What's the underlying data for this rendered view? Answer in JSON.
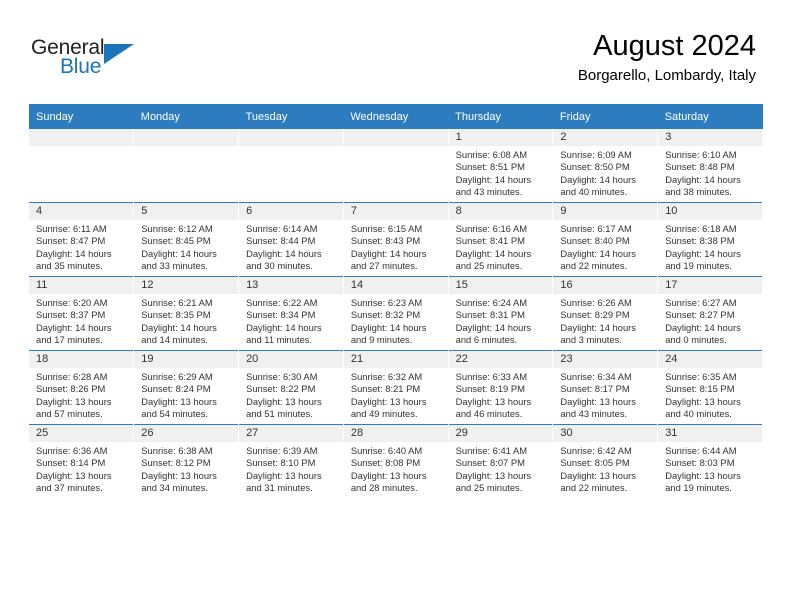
{
  "brand": {
    "name_part1": "General",
    "name_part2": "Blue",
    "accent_color": "#1b75bb"
  },
  "header": {
    "title": "August 2024",
    "location": "Borgarello, Lombardy, Italy",
    "header_bg_color": "#2e7cc0"
  },
  "weekday_headers": [
    "Sunday",
    "Monday",
    "Tuesday",
    "Wednesday",
    "Thursday",
    "Friday",
    "Saturday"
  ],
  "weeks": [
    [
      {
        "day": "",
        "empty": true
      },
      {
        "day": "",
        "empty": true
      },
      {
        "day": "",
        "empty": true
      },
      {
        "day": "",
        "empty": true
      },
      {
        "day": "1",
        "sunrise": "Sunrise: 6:08 AM",
        "sunset": "Sunset: 8:51 PM",
        "daylight_line1": "Daylight: 14 hours",
        "daylight_line2": "and 43 minutes."
      },
      {
        "day": "2",
        "sunrise": "Sunrise: 6:09 AM",
        "sunset": "Sunset: 8:50 PM",
        "daylight_line1": "Daylight: 14 hours",
        "daylight_line2": "and 40 minutes."
      },
      {
        "day": "3",
        "sunrise": "Sunrise: 6:10 AM",
        "sunset": "Sunset: 8:48 PM",
        "daylight_line1": "Daylight: 14 hours",
        "daylight_line2": "and 38 minutes."
      }
    ],
    [
      {
        "day": "4",
        "sunrise": "Sunrise: 6:11 AM",
        "sunset": "Sunset: 8:47 PM",
        "daylight_line1": "Daylight: 14 hours",
        "daylight_line2": "and 35 minutes."
      },
      {
        "day": "5",
        "sunrise": "Sunrise: 6:12 AM",
        "sunset": "Sunset: 8:45 PM",
        "daylight_line1": "Daylight: 14 hours",
        "daylight_line2": "and 33 minutes."
      },
      {
        "day": "6",
        "sunrise": "Sunrise: 6:14 AM",
        "sunset": "Sunset: 8:44 PM",
        "daylight_line1": "Daylight: 14 hours",
        "daylight_line2": "and 30 minutes."
      },
      {
        "day": "7",
        "sunrise": "Sunrise: 6:15 AM",
        "sunset": "Sunset: 8:43 PM",
        "daylight_line1": "Daylight: 14 hours",
        "daylight_line2": "and 27 minutes."
      },
      {
        "day": "8",
        "sunrise": "Sunrise: 6:16 AM",
        "sunset": "Sunset: 8:41 PM",
        "daylight_line1": "Daylight: 14 hours",
        "daylight_line2": "and 25 minutes."
      },
      {
        "day": "9",
        "sunrise": "Sunrise: 6:17 AM",
        "sunset": "Sunset: 8:40 PM",
        "daylight_line1": "Daylight: 14 hours",
        "daylight_line2": "and 22 minutes."
      },
      {
        "day": "10",
        "sunrise": "Sunrise: 6:18 AM",
        "sunset": "Sunset: 8:38 PM",
        "daylight_line1": "Daylight: 14 hours",
        "daylight_line2": "and 19 minutes."
      }
    ],
    [
      {
        "day": "11",
        "sunrise": "Sunrise: 6:20 AM",
        "sunset": "Sunset: 8:37 PM",
        "daylight_line1": "Daylight: 14 hours",
        "daylight_line2": "and 17 minutes."
      },
      {
        "day": "12",
        "sunrise": "Sunrise: 6:21 AM",
        "sunset": "Sunset: 8:35 PM",
        "daylight_line1": "Daylight: 14 hours",
        "daylight_line2": "and 14 minutes."
      },
      {
        "day": "13",
        "sunrise": "Sunrise: 6:22 AM",
        "sunset": "Sunset: 8:34 PM",
        "daylight_line1": "Daylight: 14 hours",
        "daylight_line2": "and 11 minutes."
      },
      {
        "day": "14",
        "sunrise": "Sunrise: 6:23 AM",
        "sunset": "Sunset: 8:32 PM",
        "daylight_line1": "Daylight: 14 hours",
        "daylight_line2": "and 9 minutes."
      },
      {
        "day": "15",
        "sunrise": "Sunrise: 6:24 AM",
        "sunset": "Sunset: 8:31 PM",
        "daylight_line1": "Daylight: 14 hours",
        "daylight_line2": "and 6 minutes."
      },
      {
        "day": "16",
        "sunrise": "Sunrise: 6:26 AM",
        "sunset": "Sunset: 8:29 PM",
        "daylight_line1": "Daylight: 14 hours",
        "daylight_line2": "and 3 minutes."
      },
      {
        "day": "17",
        "sunrise": "Sunrise: 6:27 AM",
        "sunset": "Sunset: 8:27 PM",
        "daylight_line1": "Daylight: 14 hours",
        "daylight_line2": "and 0 minutes."
      }
    ],
    [
      {
        "day": "18",
        "sunrise": "Sunrise: 6:28 AM",
        "sunset": "Sunset: 8:26 PM",
        "daylight_line1": "Daylight: 13 hours",
        "daylight_line2": "and 57 minutes."
      },
      {
        "day": "19",
        "sunrise": "Sunrise: 6:29 AM",
        "sunset": "Sunset: 8:24 PM",
        "daylight_line1": "Daylight: 13 hours",
        "daylight_line2": "and 54 minutes."
      },
      {
        "day": "20",
        "sunrise": "Sunrise: 6:30 AM",
        "sunset": "Sunset: 8:22 PM",
        "daylight_line1": "Daylight: 13 hours",
        "daylight_line2": "and 51 minutes."
      },
      {
        "day": "21",
        "sunrise": "Sunrise: 6:32 AM",
        "sunset": "Sunset: 8:21 PM",
        "daylight_line1": "Daylight: 13 hours",
        "daylight_line2": "and 49 minutes."
      },
      {
        "day": "22",
        "sunrise": "Sunrise: 6:33 AM",
        "sunset": "Sunset: 8:19 PM",
        "daylight_line1": "Daylight: 13 hours",
        "daylight_line2": "and 46 minutes."
      },
      {
        "day": "23",
        "sunrise": "Sunrise: 6:34 AM",
        "sunset": "Sunset: 8:17 PM",
        "daylight_line1": "Daylight: 13 hours",
        "daylight_line2": "and 43 minutes."
      },
      {
        "day": "24",
        "sunrise": "Sunrise: 6:35 AM",
        "sunset": "Sunset: 8:15 PM",
        "daylight_line1": "Daylight: 13 hours",
        "daylight_line2": "and 40 minutes."
      }
    ],
    [
      {
        "day": "25",
        "sunrise": "Sunrise: 6:36 AM",
        "sunset": "Sunset: 8:14 PM",
        "daylight_line1": "Daylight: 13 hours",
        "daylight_line2": "and 37 minutes."
      },
      {
        "day": "26",
        "sunrise": "Sunrise: 6:38 AM",
        "sunset": "Sunset: 8:12 PM",
        "daylight_line1": "Daylight: 13 hours",
        "daylight_line2": "and 34 minutes."
      },
      {
        "day": "27",
        "sunrise": "Sunrise: 6:39 AM",
        "sunset": "Sunset: 8:10 PM",
        "daylight_line1": "Daylight: 13 hours",
        "daylight_line2": "and 31 minutes."
      },
      {
        "day": "28",
        "sunrise": "Sunrise: 6:40 AM",
        "sunset": "Sunset: 8:08 PM",
        "daylight_line1": "Daylight: 13 hours",
        "daylight_line2": "and 28 minutes."
      },
      {
        "day": "29",
        "sunrise": "Sunrise: 6:41 AM",
        "sunset": "Sunset: 8:07 PM",
        "daylight_line1": "Daylight: 13 hours",
        "daylight_line2": "and 25 minutes."
      },
      {
        "day": "30",
        "sunrise": "Sunrise: 6:42 AM",
        "sunset": "Sunset: 8:05 PM",
        "daylight_line1": "Daylight: 13 hours",
        "daylight_line2": "and 22 minutes."
      },
      {
        "day": "31",
        "sunrise": "Sunrise: 6:44 AM",
        "sunset": "Sunset: 8:03 PM",
        "daylight_line1": "Daylight: 13 hours",
        "daylight_line2": "and 19 minutes."
      }
    ]
  ]
}
